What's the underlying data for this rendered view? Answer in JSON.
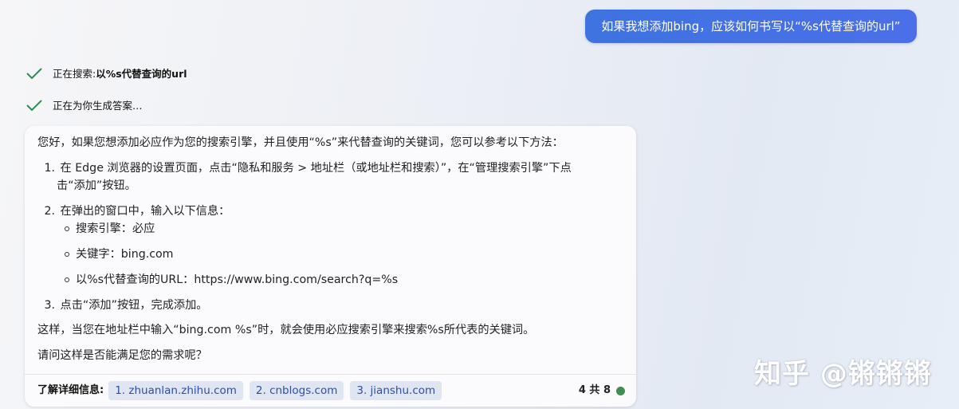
{
  "user_message": "如果我想添加bing，应该如何书写以“%s代替查询的url”",
  "status": [
    {
      "prefix": "正在搜索: ",
      "query": "以%s代替查询的url",
      "icon": "checkmark-icon"
    },
    {
      "prefix": "正在为你生成答案…",
      "query": "",
      "icon": "checkmark-icon"
    }
  ],
  "answer": {
    "intro": "您好，如果您想添加必应作为您的搜索引擎，并且使用“%s”来代替查询的关键词，您可以参考以下方法：",
    "steps": [
      {
        "num": "1.",
        "line1": "在 Edge 浏览器的设置页面，点击“隐私和服务 > 地址栏（或地址栏和搜索）”，在“管理搜索引擎”下点",
        "line2": "击“添加”按钮。"
      },
      {
        "num": "2.",
        "line1": "在弹出的窗口中，输入以下信息："
      },
      {
        "num": "3.",
        "line1": "点击“添加”按钮，完成添加。"
      }
    ],
    "sub_items": [
      "搜索引擎：必应",
      "关键字：bing.com",
      "以%s代替查询的URL：https://www.bing.com/search?q=%s"
    ],
    "conclusion": "这样，当您在地址栏中输入“bing.com %s”时，就会使用必应搜索引擎来搜索%s所代表的关键词。",
    "question": "请问这样是否能满足您的需求呢？"
  },
  "footer": {
    "label": "了解详细信息:",
    "sources": [
      "1. zhuanlan.zhihu.com",
      "2. cnblogs.com",
      "3. jianshu.com"
    ],
    "counter": "4 共 8",
    "status_color": "#3c8f50"
  },
  "watermark": "知乎 @锵锵锵",
  "colors": {
    "accent": "#4270e3",
    "check": "#2e8b57"
  }
}
